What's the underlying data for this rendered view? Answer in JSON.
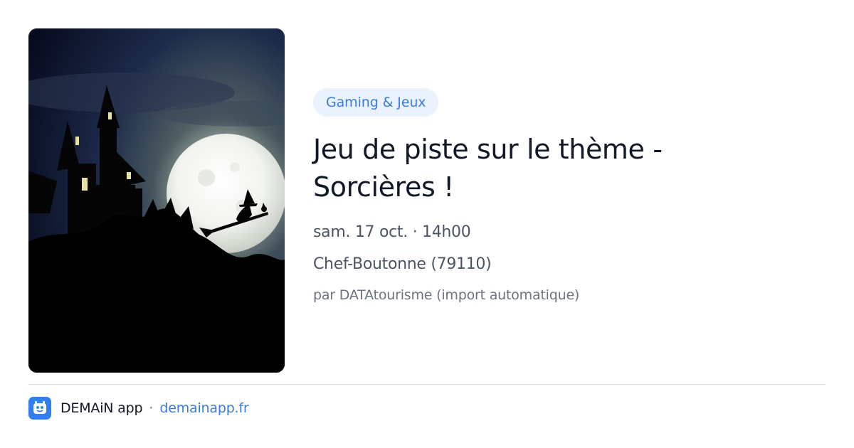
{
  "event": {
    "category": "Gaming & Jeux",
    "title": "Jeu de piste sur le thème - Sorcières !",
    "date": "sam. 17 oct. · 14h00",
    "location": "Chef-Boutonne (79110)",
    "organizer": "par DATAtourisme (import automatique)"
  },
  "footer": {
    "app_name": "DEMAiN app",
    "separator": "·",
    "link_text": "demainapp.fr"
  },
  "colors": {
    "accent": "#3b7dd8",
    "category_bg": "#eaf2fd",
    "app_icon_bg": "#2f80ed"
  },
  "icons": {
    "app": "demain-app-icon"
  },
  "cover_image": "halloween-witch-full-moon-castle"
}
